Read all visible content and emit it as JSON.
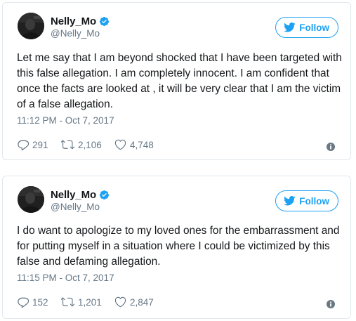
{
  "colors": {
    "accent": "#1da1f2",
    "text": "#14171a",
    "secondary_text": "#657786",
    "border": "#e1e8ed"
  },
  "tweets": [
    {
      "author": {
        "display_name": "Nelly_Mo",
        "handle": "@Nelly_Mo",
        "verified": true
      },
      "follow_label": "Follow",
      "text": "Let me say that I am beyond shocked that I have been targeted with this false allegation. I am completely innocent. I am confident that once the facts are looked at , it will be very clear that I am the victim of a false allegation.",
      "timestamp": "11:12 PM - Oct 7, 2017",
      "stats": {
        "replies": "291",
        "retweets": "2,106",
        "likes": "4,748"
      },
      "icons": [
        "verified-badge-icon",
        "twitter-bird-icon",
        "reply-icon",
        "retweet-icon",
        "like-heart-icon",
        "info-icon"
      ]
    },
    {
      "author": {
        "display_name": "Nelly_Mo",
        "handle": "@Nelly_Mo",
        "verified": true
      },
      "follow_label": "Follow",
      "text": "I do want to apologize to my loved ones for the embarrassment and for putting myself in a situation where I could be victimized by this false and defaming allegation.",
      "timestamp": "11:15 PM - Oct 7, 2017",
      "stats": {
        "replies": "152",
        "retweets": "1,201",
        "likes": "2,847"
      },
      "icons": [
        "verified-badge-icon",
        "twitter-bird-icon",
        "reply-icon",
        "retweet-icon",
        "like-heart-icon",
        "info-icon"
      ]
    }
  ]
}
